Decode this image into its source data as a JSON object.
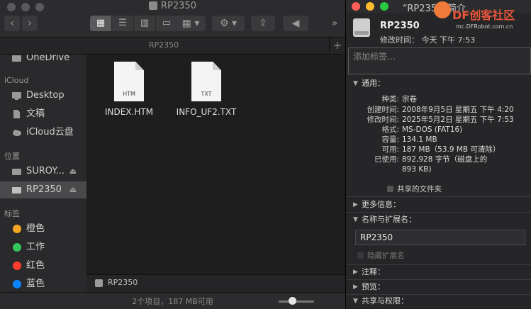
{
  "finder": {
    "title": "RP2350",
    "tab_label": "RP2350",
    "tab_add": "+",
    "toolbar": {
      "back": "‹",
      "forward": "›",
      "more": "»"
    },
    "sidebar": {
      "items_top": [
        {
          "label": "OneDrive"
        }
      ],
      "section_icloud": "iCloud",
      "icloud_items": [
        {
          "label": "Desktop"
        },
        {
          "label": "文稿"
        },
        {
          "label": "iCloud云盘"
        }
      ],
      "section_locations": "位置",
      "locations": [
        {
          "label": "SUROY..."
        },
        {
          "label": "RP2350"
        }
      ],
      "section_tags": "标签",
      "tags": [
        {
          "label": "橙色",
          "color": "#f5a623"
        },
        {
          "label": "工作",
          "color": "#34c759"
        },
        {
          "label": "红色",
          "color": "#ff3b30"
        },
        {
          "label": "蓝色",
          "color": "#0a84ff"
        }
      ]
    },
    "files": [
      {
        "name": "INDEX.HTM",
        "ext": "HTM"
      },
      {
        "name": "INFO_UF2.TXT",
        "ext": "TXT"
      }
    ],
    "path_label": "RP2350",
    "status": "2个项目，187 MB可用",
    "zoom_level": 0.3
  },
  "info": {
    "title": "“RP2350”简介",
    "name": "RP2350",
    "modified": "修改时间：  今天 下午 7:53",
    "tags_placeholder": "添加标签…",
    "general_label": "通用：",
    "general": [
      {
        "k": "种类:",
        "v": "宗卷"
      },
      {
        "k": "创建时间:",
        "v": "2008年9月5日 星期五 下午 4:20"
      },
      {
        "k": "修改时间:",
        "v": "2025年5月2日 星期五 下午 7:53"
      },
      {
        "k": "格式:",
        "v": "MS-DOS (FAT16)"
      },
      {
        "k": "容量:",
        "v": "134.1 MB"
      },
      {
        "k": "可用:",
        "v": "187 MB（53.9 MB 可清除）"
      },
      {
        "k": "已使用:",
        "v": "892,928 字节（磁盘上的"
      },
      {
        "k": "",
        "v": "893 KB)"
      }
    ],
    "shared_folder": "共享的文件夹",
    "more_info": "更多信息：",
    "name_ext_label": "名称与扩展名：",
    "name_value": "RP2350",
    "hide_ext": "隐藏扩展名",
    "comments": "注释：",
    "preview": "预览：",
    "sharing": "共享与权限："
  },
  "watermark": {
    "logo": "DF创客社区",
    "url": "mc.DFRobot.com.cn"
  }
}
